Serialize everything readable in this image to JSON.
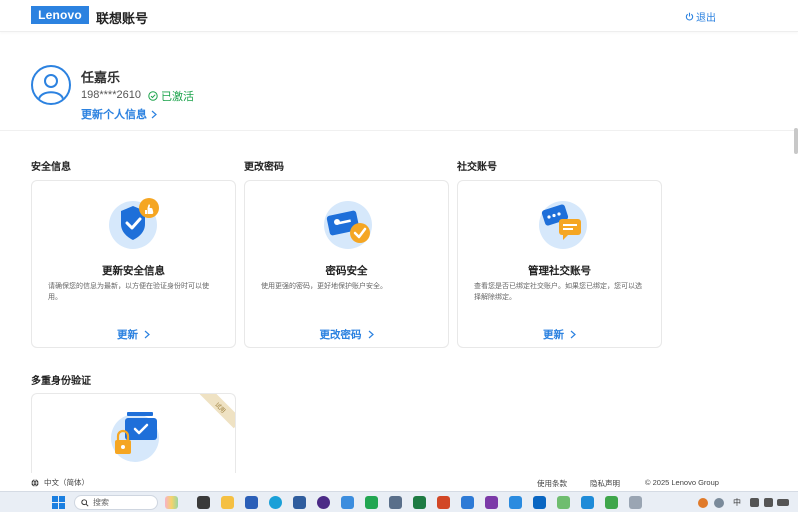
{
  "header": {
    "logo": "Lenovo",
    "title": "联想账号",
    "logout": "退出"
  },
  "profile": {
    "name": "任嘉乐",
    "phone": "198****2610",
    "status": "已激活",
    "update_link": "更新个人信息"
  },
  "sections": {
    "security": {
      "heading": "安全信息",
      "card_title": "更新安全信息",
      "desc": "请确保您的信息为最新，以方便在验证身份时可以使用。",
      "link": "更新"
    },
    "password": {
      "heading": "更改密码",
      "card_title": "密码安全",
      "desc": "使用更强的密码，更好地保护账户安全。",
      "link": "更改密码"
    },
    "social": {
      "heading": "社交账号",
      "card_title": "管理社交账号",
      "desc": "查看您是否已绑定社交账户。如果您已绑定，您可以选择解除绑定。",
      "link": "更新"
    },
    "mfa": {
      "heading": "多重身份验证",
      "ribbon": "试用"
    }
  },
  "footer": {
    "language": "中文（简体）",
    "terms": "使用条款",
    "privacy": "隐私声明",
    "copyright": "© 2025 Lenovo Group"
  },
  "taskbar": {
    "search_placeholder": "搜索",
    "ime": "中"
  },
  "colors": {
    "accent": "#2c82e0",
    "success": "#1aa34a",
    "illustration_bg": "#d6e8fb",
    "badge_orange": "#f5a623"
  }
}
